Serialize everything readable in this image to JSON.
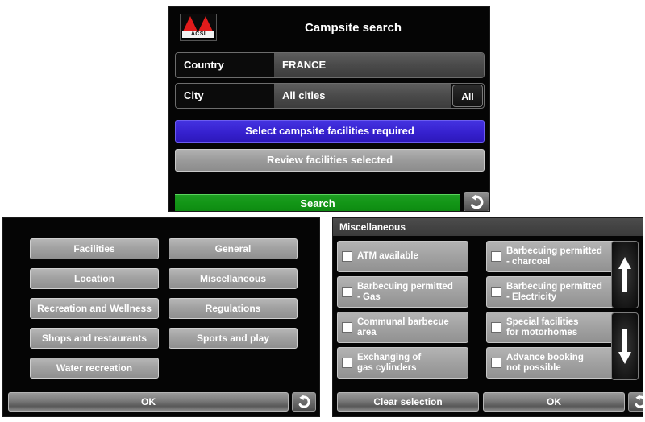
{
  "search_panel": {
    "logo_text": "ACSI",
    "title": "Campsite search",
    "fields": [
      {
        "label": "Country",
        "value": "FRANCE"
      },
      {
        "label": "City",
        "value": "All cities",
        "button": "All"
      }
    ],
    "select_facilities_label": "Select campsite facilities required",
    "review_facilities_label": "Review facilities selected",
    "search_label": "Search",
    "back_icon": "back-arrow-icon",
    "colors": {
      "select_facilities": "#3621cf",
      "review_facilities": "#9b9b9b",
      "search": "#139617",
      "logo_red": "#e21b1b"
    }
  },
  "categories_panel": {
    "items": [
      "Facilities",
      "General",
      "Location",
      "Miscellaneous",
      "Recreation and Wellness",
      "Regulations",
      "Shops and restaurants",
      "Sports and play",
      "Water recreation"
    ],
    "ok_label": "OK",
    "back_icon": "back-arrow-icon"
  },
  "misc_panel": {
    "title": "Miscellaneous",
    "checkboxes": [
      {
        "label": "ATM available",
        "checked": false
      },
      {
        "label": "Barbecuing permitted\n- charcoal",
        "checked": false
      },
      {
        "label": "Barbecuing permitted\n- Gas",
        "checked": false
      },
      {
        "label": "Barbecuing permitted\n- Electricity",
        "checked": false
      },
      {
        "label": "Communal barbecue\narea",
        "checked": false
      },
      {
        "label": "Special facilities\nfor motorhomes",
        "checked": false
      },
      {
        "label": "Exchanging of\ngas cylinders",
        "checked": false
      },
      {
        "label": "Advance booking\nnot possible",
        "checked": false
      }
    ],
    "scroll_up_icon": "arrow-up-icon",
    "scroll_down_icon": "arrow-down-icon",
    "clear_selection_label": "Clear selection",
    "ok_label": "OK",
    "back_icon": "back-arrow-icon"
  }
}
